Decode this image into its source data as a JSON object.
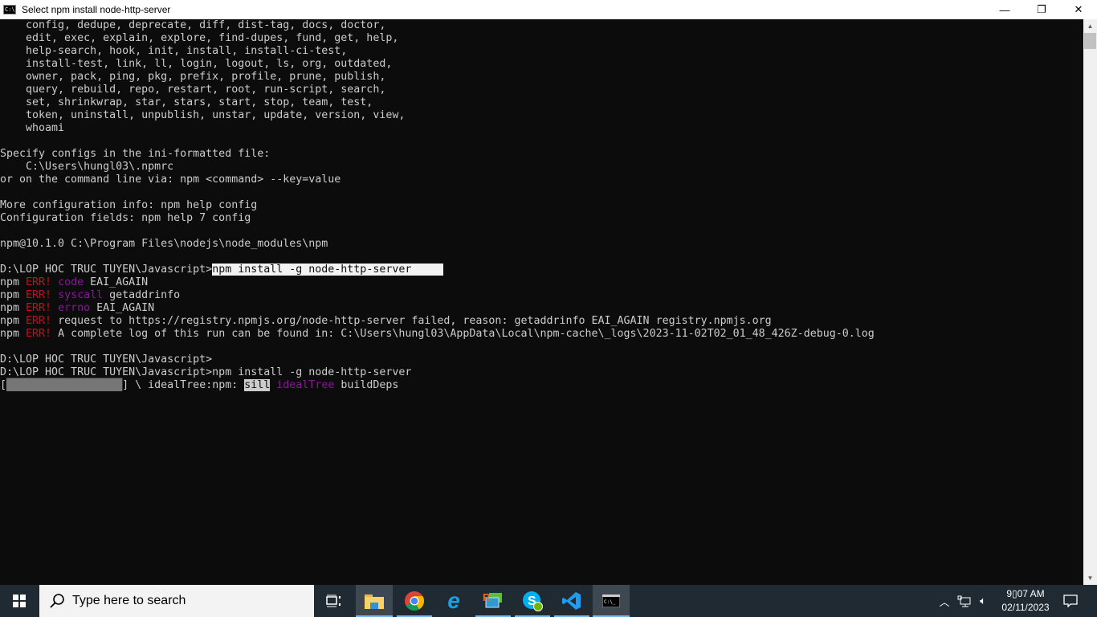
{
  "window": {
    "title": "Select npm install node-http-server",
    "icon": "cmd-icon",
    "buttons": {
      "minimize": "—",
      "maximize": "❐",
      "close": "✕"
    }
  },
  "terminal": {
    "lines": [
      [
        {
          "t": "    config, dedupe, deprecate, diff, dist-tag, docs, doctor,"
        }
      ],
      [
        {
          "t": "    edit, exec, explain, explore, find-dupes, fund, get, help,"
        }
      ],
      [
        {
          "t": "    help-search, hook, init, install, install-ci-test,"
        }
      ],
      [
        {
          "t": "    install-test, link, ll, login, logout, ls, org, outdated,"
        }
      ],
      [
        {
          "t": "    owner, pack, ping, pkg, prefix, profile, prune, publish,"
        }
      ],
      [
        {
          "t": "    query, rebuild, repo, restart, root, run-script, search,"
        }
      ],
      [
        {
          "t": "    set, shrinkwrap, star, stars, start, stop, team, test,"
        }
      ],
      [
        {
          "t": "    token, uninstall, unpublish, unstar, update, version, view,"
        }
      ],
      [
        {
          "t": "    whoami"
        }
      ],
      [],
      [
        {
          "t": "Specify configs in the ini-formatted file:"
        }
      ],
      [
        {
          "t": "    C:\\Users\\hungl03\\.npmrc"
        }
      ],
      [
        {
          "t": "or on the command line via: npm <command> --key=value"
        }
      ],
      [],
      [
        {
          "t": "More configuration info: npm help config"
        }
      ],
      [
        {
          "t": "Configuration fields: npm help 7 config"
        }
      ],
      [],
      [
        {
          "t": "npm@10.1.0 C:\\Program Files\\nodejs\\node_modules\\npm"
        }
      ],
      [],
      [
        {
          "t": "D:\\LOP HOC TRUC TUYEN\\Javascript>"
        },
        {
          "t": "npm install -g node-http-server     ",
          "c": "sel"
        }
      ],
      [
        {
          "t": "npm "
        },
        {
          "t": "ERR!",
          "c": "err"
        },
        {
          "t": " "
        },
        {
          "t": "code",
          "c": "mag"
        },
        {
          "t": " EAI_AGAIN"
        }
      ],
      [
        {
          "t": "npm "
        },
        {
          "t": "ERR!",
          "c": "err"
        },
        {
          "t": " "
        },
        {
          "t": "syscall",
          "c": "mag"
        },
        {
          "t": " getaddrinfo"
        }
      ],
      [
        {
          "t": "npm "
        },
        {
          "t": "ERR!",
          "c": "err"
        },
        {
          "t": " "
        },
        {
          "t": "errno",
          "c": "mag"
        },
        {
          "t": " EAI_AGAIN"
        }
      ],
      [
        {
          "t": "npm "
        },
        {
          "t": "ERR!",
          "c": "err"
        },
        {
          "t": " request to https://registry.npmjs.org/node-http-server failed, reason: getaddrinfo EAI_AGAIN registry.npmjs.org"
        }
      ],
      [
        {
          "t": "npm "
        },
        {
          "t": "ERR!",
          "c": "err"
        },
        {
          "t": " A complete log of this run can be found in: C:\\Users\\hungl03\\AppData\\Local\\npm-cache\\_logs\\2023-11-02T02_01_48_426Z-debug-0.log"
        }
      ],
      [],
      [
        {
          "t": "D:\\LOP HOC TRUC TUYEN\\Javascript>"
        }
      ],
      [
        {
          "t": "D:\\LOP HOC TRUC TUYEN\\Javascript>npm install -g node-http-server"
        }
      ],
      [
        {
          "t": "["
        },
        {
          "t": "██████████████████",
          "c": "bar"
        },
        {
          "t": "] \\ idealTree:npm: "
        },
        {
          "t": "sill",
          "c": "sill"
        },
        {
          "t": " "
        },
        {
          "t": "idealTree",
          "c": "mag"
        },
        {
          "t": " buildDeps"
        }
      ]
    ]
  },
  "taskbar": {
    "search_placeholder": "Type here to search",
    "apps": [
      "task-view",
      "file-explorer",
      "chrome",
      "internet-explorer",
      "remote-desktop",
      "skype",
      "vscode",
      "command-prompt"
    ],
    "clock": {
      "time": "9▯07 AM",
      "date": "02/11/2023"
    }
  },
  "colors": {
    "error": "#c50f1f",
    "keyword": "#881798",
    "text": "#cccccc",
    "bg": "#0c0c0c",
    "taskbar": "#1f2a33"
  }
}
